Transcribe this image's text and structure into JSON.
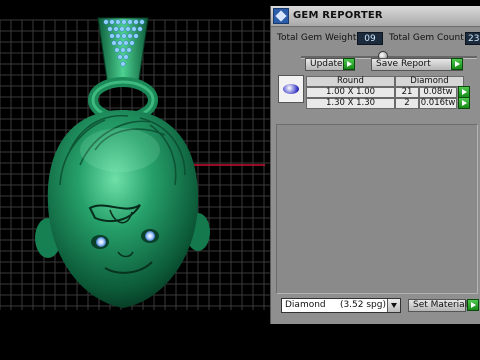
{
  "panel": {
    "title": "GEM REPORTER",
    "total_gem_weight_label": "Total Gem Weight",
    "total_gem_weight_value": "09",
    "total_gem_count_label": "Total Gem Count",
    "total_gem_count_value": "23",
    "update_label": "Update",
    "save_report_label": "Save Report",
    "table": {
      "columns": [
        "Round",
        "Diamond"
      ],
      "rows": [
        {
          "size": "1.00 X 1.00",
          "count": "21",
          "weight": "0.08tw"
        },
        {
          "size": "1.30 X 1.30",
          "count": "2",
          "weight": "0.016tw"
        }
      ]
    },
    "material_value": "Diamond     (3.52 spg)",
    "set_material_label": "Set Material"
  },
  "colors": {
    "viewport_bg": "#000000",
    "grid": "#3a3a3a",
    "model_green": "#1f8f5c",
    "panel_bg": "#8f8f8f",
    "accent_red": "#c8102e",
    "go_green": "#2aa82a"
  },
  "icons": [
    "gem-reporter-icon",
    "play-arrow-icon",
    "round-gem-icon",
    "dropdown-arrow-icon"
  ]
}
